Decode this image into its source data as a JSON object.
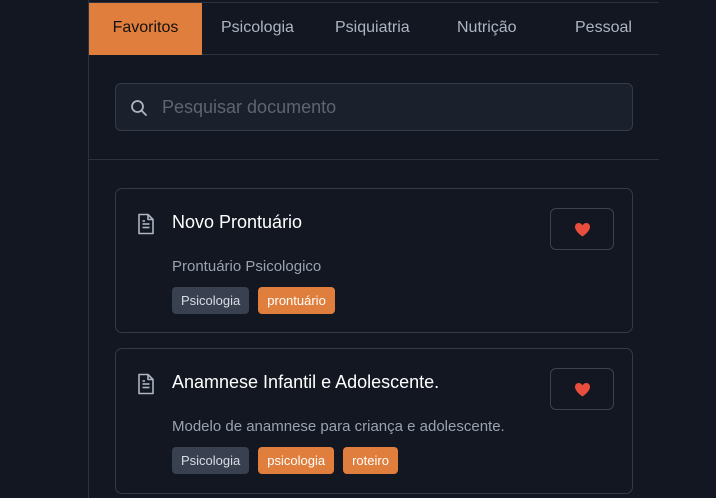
{
  "tabs": [
    {
      "label": "Favoritos",
      "active": true
    },
    {
      "label": "Psicologia",
      "active": false
    },
    {
      "label": "Psiquiatria",
      "active": false
    },
    {
      "label": "Nutrição",
      "active": false
    },
    {
      "label": "Pessoal",
      "active": false
    }
  ],
  "search": {
    "placeholder": "Pesquisar documento",
    "value": "",
    "icon": "search-icon"
  },
  "documents": [
    {
      "title": "Novo Prontuário",
      "description": "Prontuário Psicologico",
      "tags": [
        {
          "label": "Psicologia",
          "style": "gray"
        },
        {
          "label": "prontuário",
          "style": "orange"
        }
      ],
      "favorite": true,
      "icon": "document-icon"
    },
    {
      "title": "Anamnese Infantil e Adolescente.",
      "description": "Modelo de anamnese para criança e adolescente.",
      "tags": [
        {
          "label": "Psicologia",
          "style": "gray"
        },
        {
          "label": "psicologia",
          "style": "orange"
        },
        {
          "label": "roteiro",
          "style": "orange"
        }
      ],
      "favorite": true,
      "icon": "document-icon"
    }
  ],
  "colors": {
    "background": "#121722",
    "accent": "#e07f3d",
    "heart": "#e84d3d",
    "tag_gray": "#394150"
  }
}
